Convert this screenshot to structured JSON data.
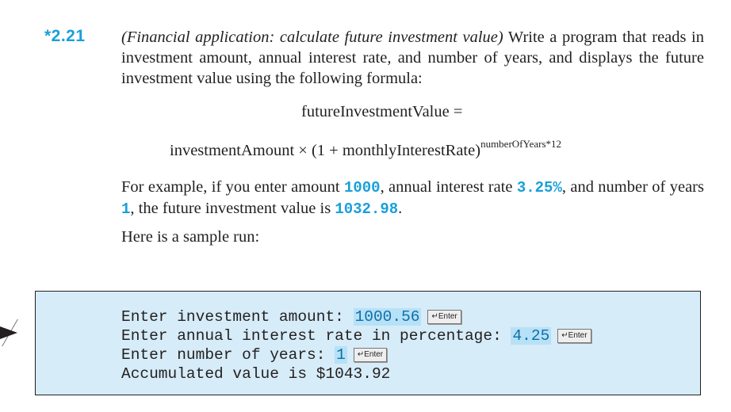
{
  "exercise": {
    "number": "*2.21",
    "title_italic": "(Financial application: calculate future investment value)",
    "description": " Write a program that reads in investment amount, annual interest rate, and number of years, and displays the future investment value using the following formula:"
  },
  "formula": {
    "lhs": "futureInvestmentValue =",
    "rhs_main": "investmentAmount × (1 + monthlyInterestRate)",
    "rhs_exponent": "numberOfYears*12"
  },
  "example": {
    "t1": "For example, if you enter amount ",
    "v1": "1000",
    "t2": ", annual interest rate ",
    "v2": "3.25%",
    "t3": ", and number of years ",
    "v3": "1",
    "t4": ", the future investment value is ",
    "v4": "1032.98",
    "t5": "."
  },
  "sample_intro": "Here is a sample run:",
  "sample_run": {
    "enter_key_label": "↵Enter",
    "line1_prompt": "Enter investment amount: ",
    "line1_input": "1000.56",
    "line2_prompt": "Enter annual interest rate in percentage: ",
    "line2_input": "4.25",
    "line3_prompt": "Enter number of years: ",
    "line3_input": "1",
    "line4_output": "Accumulated value is $1043.92"
  }
}
